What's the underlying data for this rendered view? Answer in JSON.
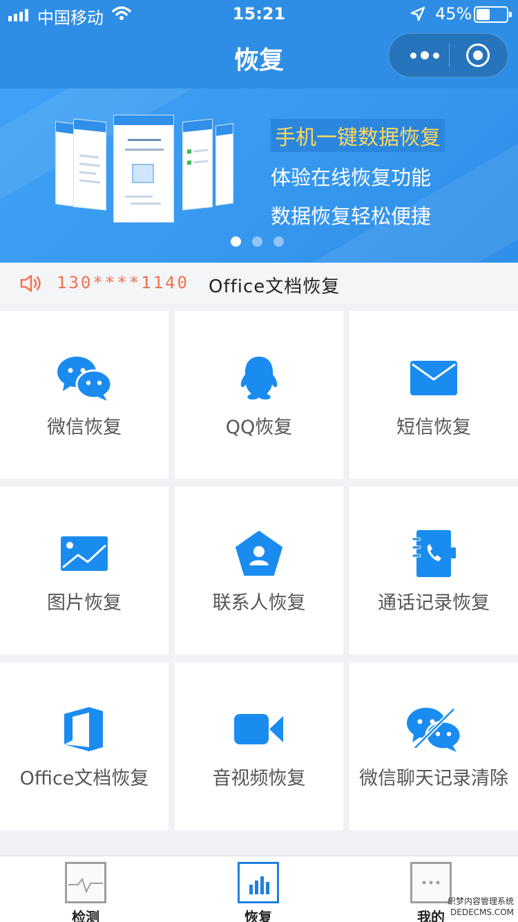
{
  "status": {
    "carrier": "中国移动",
    "time": "15:21",
    "battery_pct": "45%",
    "battery_level": 0.45
  },
  "nav": {
    "title": "恢复"
  },
  "banner": {
    "headline": "手机一键数据恢复",
    "line1": "体验在线恢复功能",
    "line2": "数据恢复轻松便捷",
    "page_count": 3,
    "active_page": 1
  },
  "notice": {
    "phone": "130****1140",
    "text": "Office文档恢复"
  },
  "grid": {
    "items": [
      {
        "label": "微信恢复",
        "icon": "wechat-icon"
      },
      {
        "label": "QQ恢复",
        "icon": "qq-icon"
      },
      {
        "label": "短信恢复",
        "icon": "sms-icon"
      },
      {
        "label": "图片恢复",
        "icon": "image-icon"
      },
      {
        "label": "联系人恢复",
        "icon": "contact-icon"
      },
      {
        "label": "通话记录恢复",
        "icon": "call-log-icon"
      },
      {
        "label": "Office文档恢复",
        "icon": "office-icon"
      },
      {
        "label": "音视频恢复",
        "icon": "video-icon"
      },
      {
        "label": "微信聊天记录清除",
        "icon": "wechat-clear-icon"
      }
    ]
  },
  "tabs": [
    {
      "label": "检测",
      "icon": "pulse-icon",
      "active": false
    },
    {
      "label": "恢复",
      "icon": "chart-icon",
      "active": true
    },
    {
      "label": "我的",
      "icon": "more-icon",
      "active": false
    }
  ],
  "watermark": {
    "line1": "织梦内容管理系统",
    "line2": "DEDECMS.COM"
  },
  "colors": {
    "primary": "#2e8ee6",
    "icon_blue": "#1a8cf0",
    "notice_orange": "#f2714f",
    "headline_yellow": "#ffd85a"
  }
}
